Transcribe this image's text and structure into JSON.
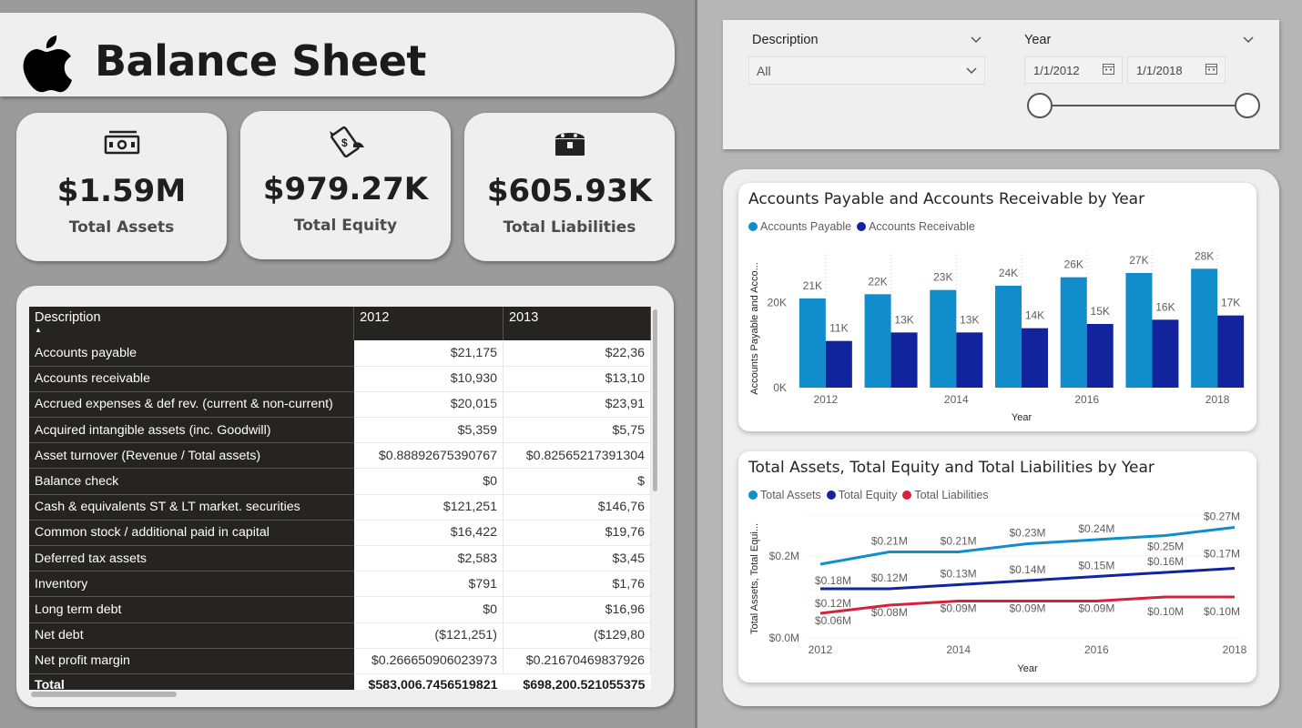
{
  "header": {
    "title": "Balance Sheet"
  },
  "kpis": [
    {
      "value": "$1.59M",
      "label": "Total Assets",
      "icon": "cash-icon"
    },
    {
      "value": "$979.27K",
      "label": "Total Equity",
      "icon": "flying-money-icon"
    },
    {
      "value": "$605.93K",
      "label": "Total Liabilities",
      "icon": "treasure-chest-icon"
    }
  ],
  "table": {
    "columns": [
      "Description",
      "2012",
      "2013"
    ],
    "rows": [
      {
        "desc": "Accounts payable",
        "y2012": "$21,175",
        "y2013": "$22,36"
      },
      {
        "desc": "Accounts receivable",
        "y2012": "$10,930",
        "y2013": "$13,10"
      },
      {
        "desc": "Accrued expenses & def rev. (current & non-current)",
        "y2012": "$20,015",
        "y2013": "$23,91"
      },
      {
        "desc": "Acquired intangible assets (inc. Goodwill)",
        "y2012": "$5,359",
        "y2013": "$5,75"
      },
      {
        "desc": "Asset turnover (Revenue / Total assets)",
        "y2012": "$0.88892675390767",
        "y2013": "$0.82565217391304"
      },
      {
        "desc": "Balance check",
        "y2012": "$0",
        "y2013": "$"
      },
      {
        "desc": "Cash & equivalents ST & LT market. securities",
        "y2012": "$121,251",
        "y2013": "$146,76"
      },
      {
        "desc": "Common stock / additional paid in capital",
        "y2012": "$16,422",
        "y2013": "$19,76"
      },
      {
        "desc": "Deferred tax assets",
        "y2012": "$2,583",
        "y2013": "$3,45"
      },
      {
        "desc": "Inventory",
        "y2012": "$791",
        "y2013": "$1,76"
      },
      {
        "desc": "Long term debt",
        "y2012": "$0",
        "y2013": "$16,96"
      },
      {
        "desc": "Net debt",
        "y2012": "($121,251)",
        "y2013": "($129,80"
      },
      {
        "desc": "Net profit margin",
        "y2012": "$0.266650906023973",
        "y2013": "$0.21670469837926"
      }
    ],
    "total": {
      "label": "Total",
      "y2012": "$583,006.7456519821",
      "y2013": "$698,200.521055375"
    }
  },
  "filters": {
    "description_label": "Description",
    "description_value": "All",
    "year_label": "Year",
    "date_start": "1/1/2012",
    "date_end": "1/1/2018"
  },
  "chart_data": [
    {
      "type": "bar",
      "title": "Accounts Payable and Accounts Receivable by Year",
      "xlabel": "Year",
      "ylabel": "Accounts Payable and Acco...",
      "categories": [
        "2012",
        "2013",
        "2014",
        "2015",
        "2016",
        "2017",
        "2018"
      ],
      "x_tick_labels": [
        "2012",
        "",
        "2014",
        "",
        "2016",
        "",
        "2018"
      ],
      "y_tick_labels": [
        "0K",
        "20K"
      ],
      "ylim": [
        0,
        30
      ],
      "series": [
        {
          "name": "Accounts Payable",
          "color": "#118dcc",
          "values": [
            21,
            22,
            23,
            24,
            26,
            27,
            28
          ],
          "labels": [
            "21K",
            "22K",
            "23K",
            "24K",
            "26K",
            "27K",
            "28K"
          ]
        },
        {
          "name": "Accounts Receivable",
          "color": "#12239e",
          "values": [
            11,
            13,
            13,
            14,
            15,
            16,
            17
          ],
          "labels": [
            "11K",
            "13K",
            "13K",
            "14K",
            "15K",
            "16K",
            "17K"
          ]
        }
      ],
      "legend": "top-left"
    },
    {
      "type": "line",
      "title": "Total Assets, Total Equity and Total Liabilities by Year",
      "xlabel": "Year",
      "ylabel": "Total Assets, Total Equi...",
      "x": [
        "2012",
        "2013",
        "2014",
        "2015",
        "2016",
        "2017",
        "2018"
      ],
      "x_tick_labels": [
        "2012",
        "",
        "2014",
        "",
        "2016",
        "",
        "2018"
      ],
      "y_tick_labels": [
        "$0.0M",
        "$0.2M"
      ],
      "series": [
        {
          "name": "Total Assets",
          "color": "#118dcc",
          "values": [
            0.18,
            0.21,
            0.21,
            0.23,
            0.24,
            0.25,
            0.27
          ],
          "labels": [
            "$0.18M",
            "$0.21M",
            "$0.21M",
            "$0.23M",
            "$0.24M",
            "$0.25M",
            "$0.27M"
          ]
        },
        {
          "name": "Total Equity",
          "color": "#12239e",
          "values": [
            0.12,
            0.12,
            0.13,
            0.14,
            0.15,
            0.16,
            0.17
          ],
          "labels": [
            "$0.12M",
            "$0.12M",
            "$0.13M",
            "$0.14M",
            "$0.15M",
            "$0.16M",
            "$0.17M"
          ]
        },
        {
          "name": "Total Liabilities",
          "color": "#d4213d",
          "values": [
            0.06,
            0.08,
            0.09,
            0.09,
            0.09,
            0.1,
            0.1
          ],
          "labels": [
            "$0.06M",
            "$0.08M",
            "$0.09M",
            "$0.09M",
            "$0.09M",
            "$0.10M",
            "$0.10M"
          ]
        }
      ],
      "legend": "top-left"
    }
  ]
}
